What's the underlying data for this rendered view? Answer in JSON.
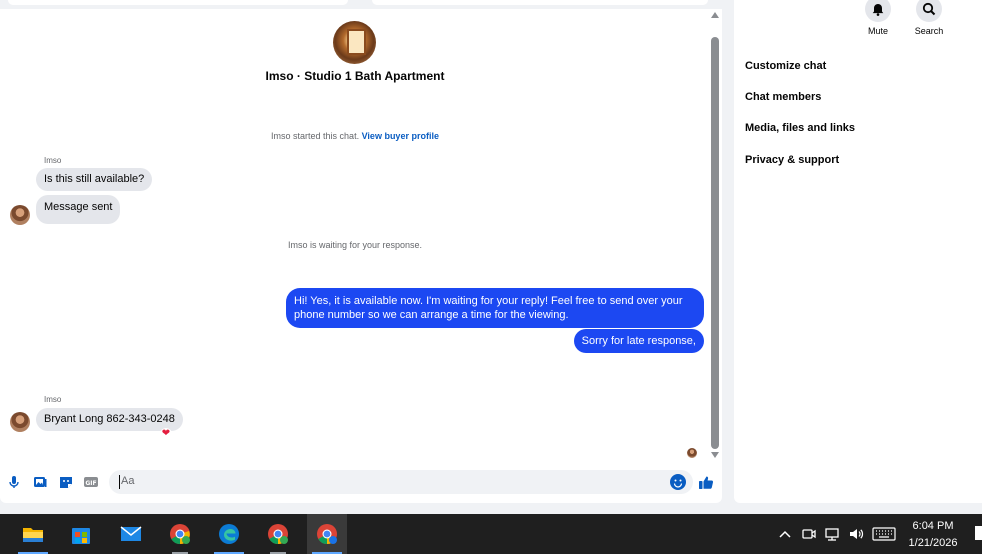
{
  "chat": {
    "title": "Imso · Studio 1 Bath Apartment",
    "started_prefix": "Imso started this chat.",
    "started_link": "View buyer profile",
    "waiting_notice": "Imso is waiting for your response.",
    "messages": [
      {
        "sender": "Imso",
        "text": "Is this still available?"
      },
      {
        "text": "Message sent"
      },
      {
        "text": "Hi! Yes, it is available now. I'm waiting for your reply! Feel free to send over your phone number so we can arrange a time for the viewing."
      },
      {
        "text": "Sorry for late response,"
      },
      {
        "sender": "Imso",
        "text": "Bryant Long 862-343-0248",
        "reaction": "heart"
      }
    ],
    "composer": {
      "placeholder": "Aa"
    }
  },
  "details": {
    "actions": [
      {
        "label": "Mute",
        "icon": "bell-icon"
      },
      {
        "label": "Search",
        "icon": "search-icon"
      }
    ],
    "items": [
      "Customize chat",
      "Chat members",
      "Media, files and links",
      "Privacy & support"
    ]
  },
  "taskbar": {
    "apps": [
      {
        "name": "file-explorer",
        "icon": "folder-icon"
      },
      {
        "name": "microsoft-store",
        "icon": "store-icon"
      },
      {
        "name": "mail",
        "icon": "mail-icon"
      },
      {
        "name": "chrome-profile-1",
        "icon": "chrome-icon"
      },
      {
        "name": "edge",
        "icon": "edge-icon"
      },
      {
        "name": "chrome-profile-2",
        "icon": "chrome-icon"
      },
      {
        "name": "chrome-profile-3",
        "icon": "chrome-icon"
      }
    ],
    "time": "6:04 PM",
    "date": "1/21/2026"
  },
  "colors": {
    "outgoing_bubble": "#1c48f2",
    "incoming_bubble": "#e4e6eb",
    "accent": "#0a5dc2",
    "taskbar": "#1f1f1f"
  }
}
